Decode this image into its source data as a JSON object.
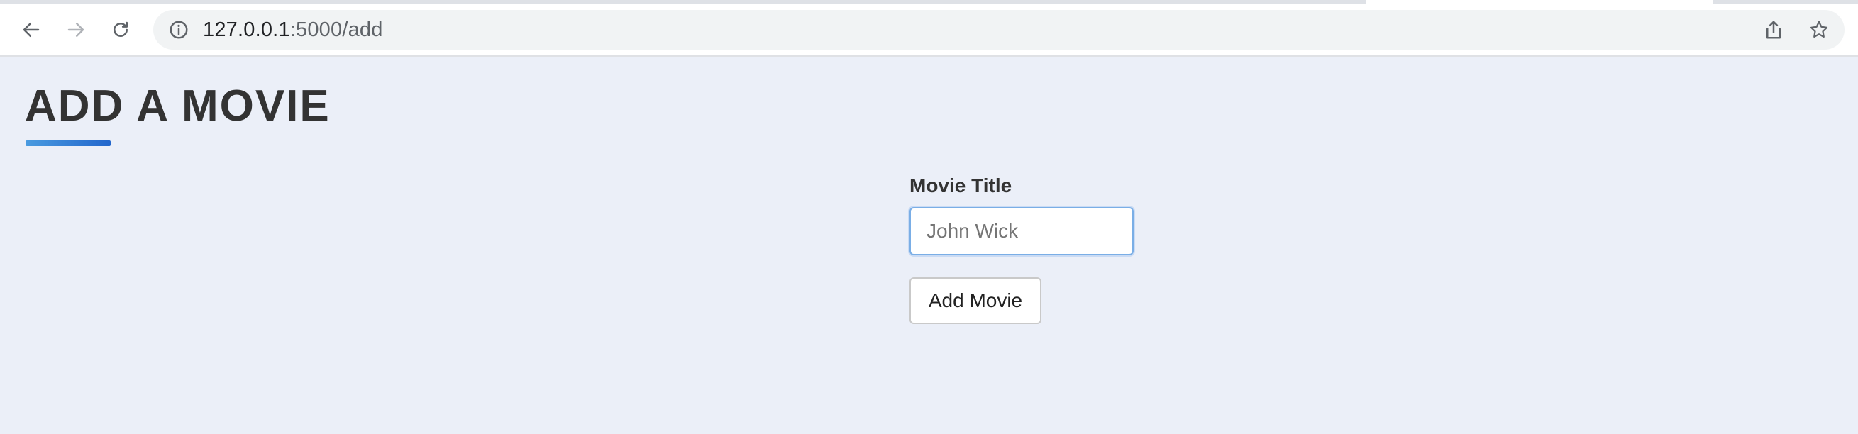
{
  "browser": {
    "url_host": "127.0.0.1",
    "url_path": ":5000/add",
    "icons": {
      "back": "back-arrow-icon",
      "forward": "forward-arrow-icon",
      "reload": "reload-icon",
      "info": "info-icon",
      "share": "share-icon",
      "bookmark": "star-icon"
    }
  },
  "page": {
    "title": "ADD A MOVIE",
    "accent_color": "#2266cc",
    "background_color": "#ebeff8"
  },
  "form": {
    "title_label": "Movie Title",
    "title_placeholder": "John Wick",
    "title_value": "",
    "submit_label": "Add Movie"
  }
}
